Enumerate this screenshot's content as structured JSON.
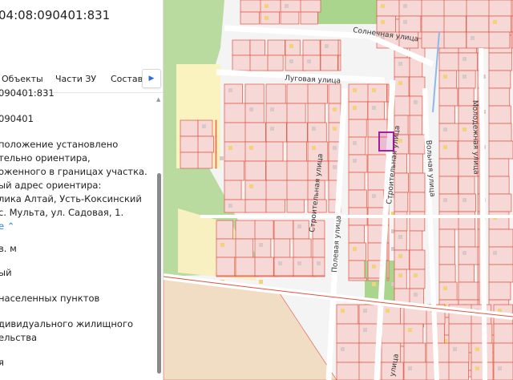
{
  "parcel": {
    "title": "04:08:090401:831",
    "tabs": [
      "Объекты",
      "Части ЗУ",
      "Состав"
    ],
    "next_tab_icon": "chevron-right-icon",
    "lines": [
      "090401:831",
      "090401",
      "положение установлено",
      "тельно ориентира,",
      "оженного в границах участка.",
      "ый адрес ориентира:",
      "лика Алтай, Усть-Коксинский",
      "с. Мульта, ул. Садовая, 1."
    ],
    "collapse_link": "е",
    "area_unit": "в. м",
    "status": "ый",
    "category": "населенных пунктов",
    "use_line1": "дивидуального жилищного",
    "use_line2": "ельства",
    "last": "я"
  },
  "map": {
    "streets": [
      "Солнечная улица",
      "Луговая улица",
      "Строительная улица",
      "Строительная улица",
      "Полевая улица",
      "Вольная улица",
      "Молодежная улица",
      "улица"
    ],
    "colors": {
      "parcel_fill": "#f6d9d7",
      "parcel_stroke": "#e0533f",
      "green": "#b9dba0",
      "field": "#f1dcc4",
      "selected": "#a020a0"
    }
  }
}
